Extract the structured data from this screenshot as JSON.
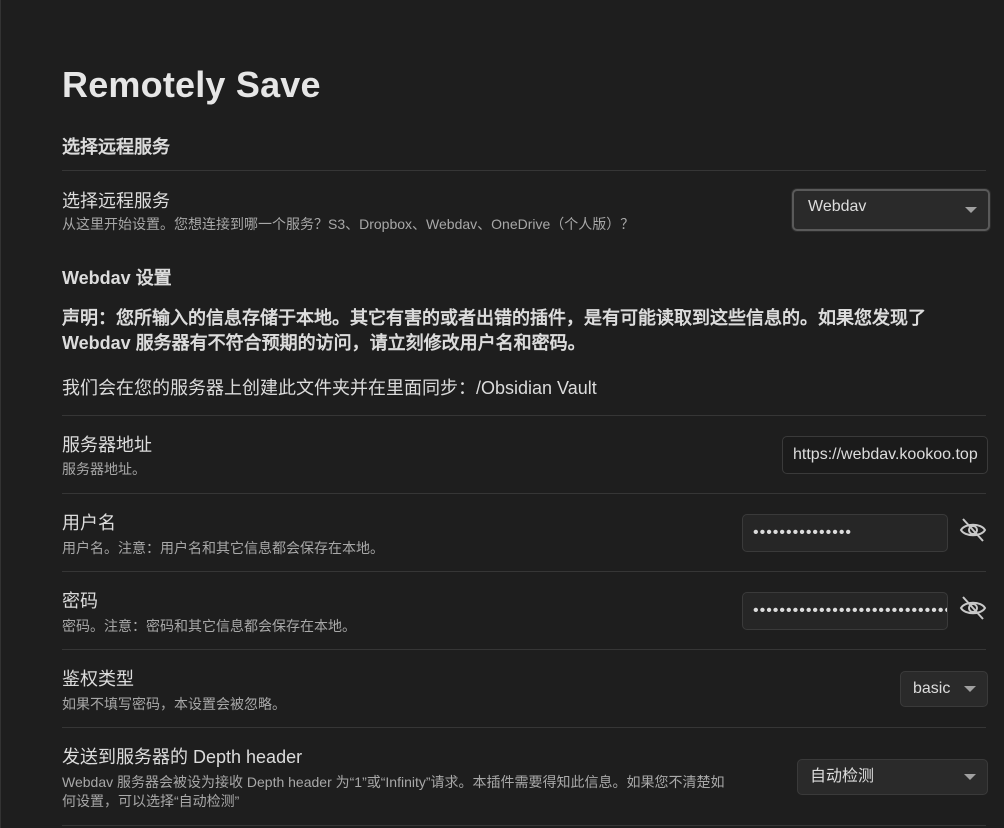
{
  "page": {
    "title": "Remotely Save"
  },
  "section_choose": {
    "heading": "选择远程服务"
  },
  "service": {
    "name": "选择远程服务",
    "desc": "从这里开始设置。您想连接到哪一个服务？S3、Dropbox、Webdav、OneDrive（个人版）？",
    "value": "Webdav"
  },
  "section_webdav": {
    "heading": "Webdav 设置"
  },
  "notice": {
    "line1": "声明：您所输入的信息存储于本地。其它有害的或者出错的插件，是有可能读取到这些信息的。如果您发现了",
    "line2": "Webdav 服务器有不符合预期的访问，请立刻修改用户名和密码。"
  },
  "folder_info": "我们会在您的服务器上创建此文件夹并在里面同步：/Obsidian Vault",
  "server": {
    "name": "服务器地址",
    "desc": "服务器地址。",
    "value": "https://webdav.kookoo.top"
  },
  "username": {
    "name": "用户名",
    "desc": "用户名。注意：用户名和其它信息都会保存在本地。",
    "value": "•••••••••••••••"
  },
  "password": {
    "name": "密码",
    "desc": "密码。注意：密码和其它信息都会保存在本地。",
    "value": "••••••••••••••••••••••••••••••••"
  },
  "auth": {
    "name": "鉴权类型",
    "desc": "如果不填写密码，本设置会被忽略。",
    "value": "basic"
  },
  "depth": {
    "name": "发送到服务器的 Depth header",
    "desc_line1": "Webdav 服务器会被设为接收 Depth header 为“1”或“Infinity”请求。本插件需要得知此信息。如果您不清楚如",
    "desc_line2": "何设置，可以选择“自动检测”",
    "value": "自动检测"
  },
  "icons": {
    "reveal": "eye-off-icon",
    "caret": "chevron-down-icon"
  }
}
